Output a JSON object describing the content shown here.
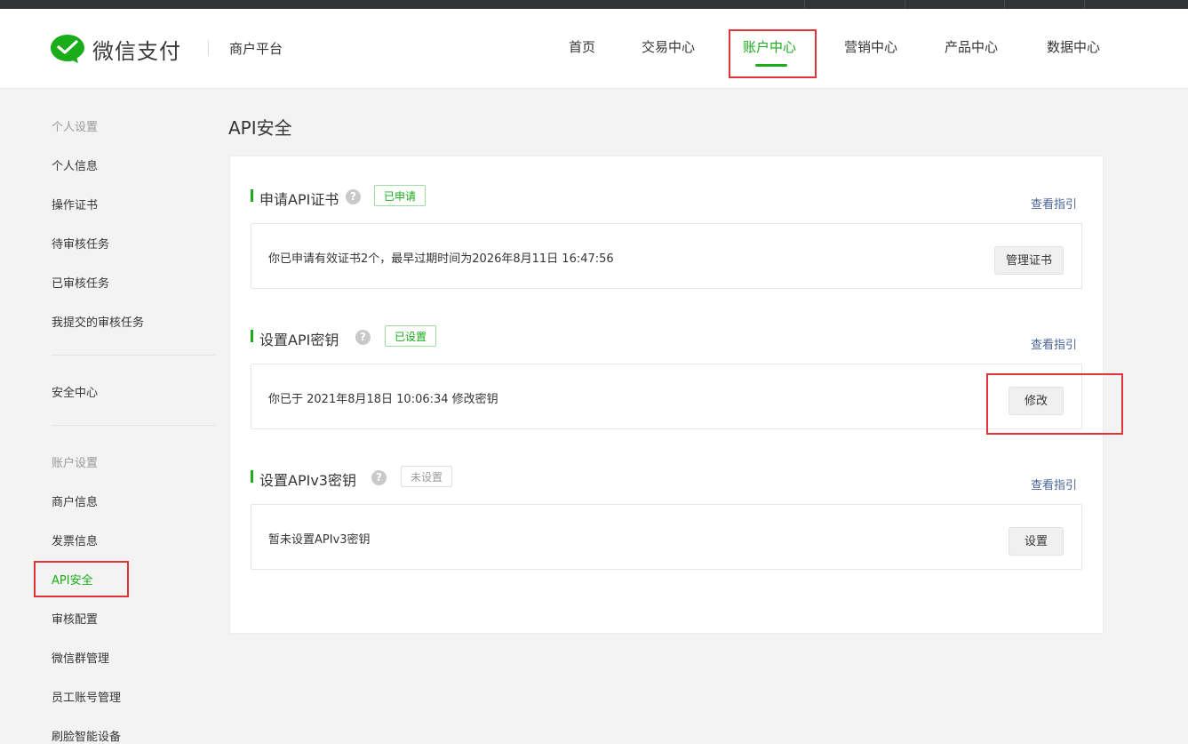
{
  "header": {
    "brand": "微信支付",
    "platform": "商户平台",
    "nav": [
      "首页",
      "交易中心",
      "账户中心",
      "营销中心",
      "产品中心",
      "数据中心"
    ],
    "active_nav": "账户中心"
  },
  "sidebar": {
    "group_personal": "个人设置",
    "personal_items": [
      "个人信息",
      "操作证书",
      "待审核任务",
      "已审核任务",
      "我提交的审核任务"
    ],
    "security_center": "安全中心",
    "group_account": "账户设置",
    "account_items": [
      "商户信息",
      "发票信息",
      "API安全",
      "审核配置",
      "微信群管理",
      "员工账号管理",
      "刷脸智能设备"
    ],
    "active_item": "API安全"
  },
  "main": {
    "title": "API安全",
    "sections": [
      {
        "title": "申请API证书",
        "help": "?",
        "status": "已申请",
        "guide": "查看指引",
        "info": "你已申请有效证书2个，最早过期时间为2026年8月11日 16:47:56",
        "action": "管理证书"
      },
      {
        "title": "设置API密钥",
        "help": "?",
        "status": "已设置",
        "guide": "查看指引",
        "info": "你已于 2021年8月18日 10:06:34 修改密钥",
        "action": "修改"
      },
      {
        "title": "设置APIv3密钥",
        "help": "?",
        "status": "未设置",
        "guide": "查看指引",
        "info": "暂未设置APIv3密钥",
        "action": "设置"
      }
    ]
  },
  "colors": {
    "accent": "#1aad19",
    "highlight_box": "#e0333a",
    "link": "#4a6496",
    "top_strip": "#323437"
  },
  "icons": [
    "wechat-pay-logo-icon",
    "help-icon"
  ]
}
